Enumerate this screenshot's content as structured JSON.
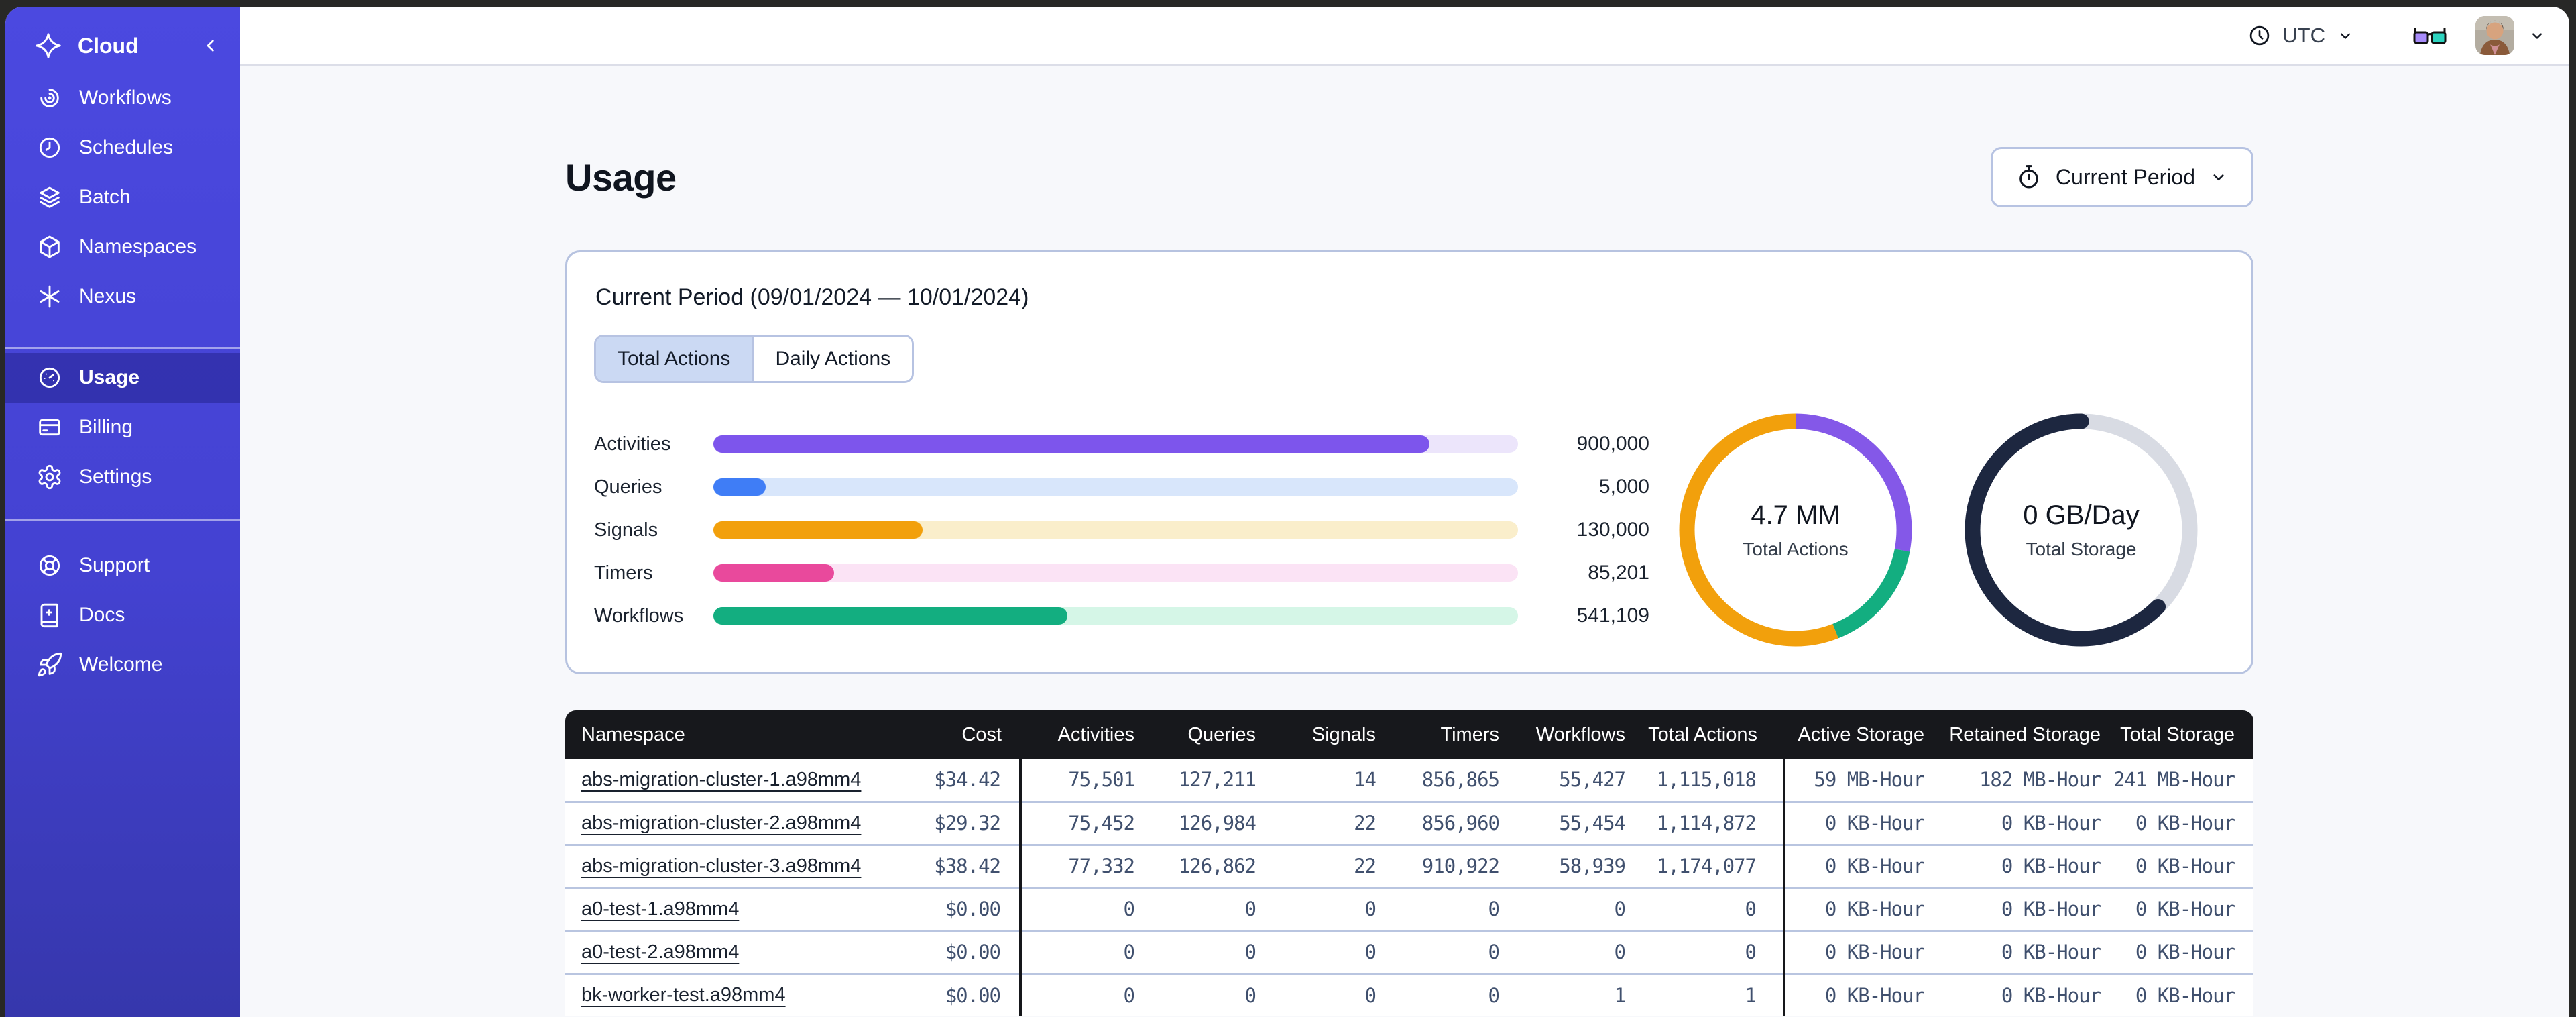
{
  "sidebar": {
    "brand_label": "Cloud",
    "nav_main": [
      {
        "icon": "workflows",
        "label": "Workflows",
        "selected": false
      },
      {
        "icon": "schedules",
        "label": "Schedules",
        "selected": false
      },
      {
        "icon": "batch",
        "label": "Batch",
        "selected": false
      },
      {
        "icon": "namespaces",
        "label": "Namespaces",
        "selected": false
      },
      {
        "icon": "nexus",
        "label": "Nexus",
        "selected": false
      }
    ],
    "nav_account": [
      {
        "icon": "usage",
        "label": "Usage",
        "selected": true
      },
      {
        "icon": "billing",
        "label": "Billing",
        "selected": false
      },
      {
        "icon": "settings",
        "label": "Settings",
        "selected": false
      }
    ],
    "nav_help": [
      {
        "icon": "support",
        "label": "Support",
        "selected": false
      },
      {
        "icon": "docs",
        "label": "Docs",
        "selected": false
      },
      {
        "icon": "welcome",
        "label": "Welcome",
        "selected": false
      }
    ]
  },
  "topbar": {
    "timezone": "UTC"
  },
  "page": {
    "title": "Usage",
    "period_button_label": "Current Period"
  },
  "usage_card": {
    "title": "Current Period (09/01/2024 — 10/01/2024)",
    "tabs": [
      {
        "label": "Total Actions",
        "active": true
      },
      {
        "label": "Daily Actions",
        "active": false
      }
    ]
  },
  "chart_data": [
    {
      "type": "bar",
      "title": "Actions by type, current period",
      "categories": [
        "Activities",
        "Queries",
        "Signals",
        "Timers",
        "Workflows"
      ],
      "values": [
        900000,
        5000,
        130000,
        85201,
        541109
      ],
      "display_values": [
        "900,000",
        "5,000",
        "130,000",
        "85,201",
        "541,109"
      ],
      "colors": [
        "#7d55ec",
        "#3f7df6",
        "#f2a00c",
        "#e9499c",
        "#13ae80"
      ],
      "track_colors": [
        "#ece5fb",
        "#d8e6fb",
        "#faeecb",
        "#fbe3f5",
        "#d5f6e7"
      ],
      "fill_pct": [
        89,
        6.5,
        26,
        15,
        44
      ],
      "xlabel": "",
      "ylabel": ""
    },
    {
      "type": "donut",
      "center_value": "4.7 MM",
      "center_label": "Total Actions",
      "linecap": "butt",
      "segments": [
        {
          "name": "Activities",
          "color": "#8458e8",
          "pct": 28
        },
        {
          "name": "Workflows",
          "color": "#13ae80",
          "pct": 16
        },
        {
          "name": "Signals",
          "color": "#f2a00c",
          "pct": 56
        }
      ]
    },
    {
      "type": "donut",
      "center_value": "0 GB/Day",
      "center_label": "Total Storage",
      "linecap": "round",
      "track_color": "#d8dbe3",
      "segments": [
        {
          "name": "Storage",
          "color": "#1d2740",
          "pct": 62.5,
          "start": 37.5
        }
      ]
    }
  ],
  "table": {
    "columns": [
      "Namespace",
      "Cost",
      "Activities",
      "Queries",
      "Signals",
      "Timers",
      "Workflows",
      "Total Actions",
      "Active Storage",
      "Retained Storage",
      "Total Storage"
    ],
    "rows": [
      [
        "abs-migration-cluster-1.a98mm4",
        "$34.42",
        "75,501",
        "127,211",
        "14",
        "856,865",
        "55,427",
        "1,115,018",
        "59 MB-Hour",
        "182 MB-Hour",
        "241 MB-Hour"
      ],
      [
        "abs-migration-cluster-2.a98mm4",
        "$29.32",
        "75,452",
        "126,984",
        "22",
        "856,960",
        "55,454",
        "1,114,872",
        "0 KB-Hour",
        "0 KB-Hour",
        "0 KB-Hour"
      ],
      [
        "abs-migration-cluster-3.a98mm4",
        "$38.42",
        "77,332",
        "126,862",
        "22",
        "910,922",
        "58,939",
        "1,174,077",
        "0 KB-Hour",
        "0 KB-Hour",
        "0 KB-Hour"
      ],
      [
        "a0-test-1.a98mm4",
        "$0.00",
        "0",
        "0",
        "0",
        "0",
        "0",
        "0",
        "0 KB-Hour",
        "0 KB-Hour",
        "0 KB-Hour"
      ],
      [
        "a0-test-2.a98mm4",
        "$0.00",
        "0",
        "0",
        "0",
        "0",
        "0",
        "0",
        "0 KB-Hour",
        "0 KB-Hour",
        "0 KB-Hour"
      ],
      [
        "bk-worker-test.a98mm4",
        "$0.00",
        "0",
        "0",
        "0",
        "0",
        "1",
        "1",
        "0 KB-Hour",
        "0 KB-Hour",
        "0 KB-Hour"
      ]
    ]
  }
}
